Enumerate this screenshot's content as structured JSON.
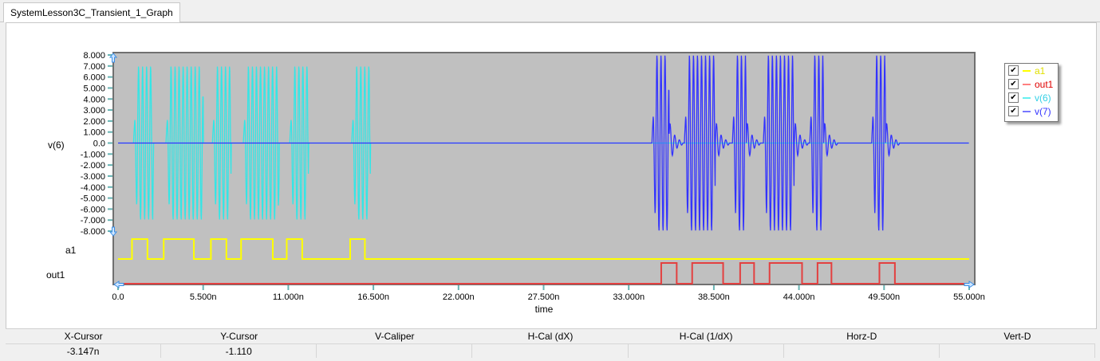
{
  "tab": {
    "title": "SystemLesson3C_Transient_1_Graph"
  },
  "colors": {
    "a1": "#ffff00",
    "out1": "#e34040",
    "v6": "#33e6e6",
    "v7": "#3333ff",
    "plot_bg": "#c0c0c0"
  },
  "chart_data": {
    "type": "line",
    "xlabel": "time",
    "xlim": [
      0,
      55
    ],
    "x_unit": "n",
    "x_ticks": [
      "0.0",
      "5.500n",
      "11.000n",
      "16.500n",
      "22.000n",
      "27.500n",
      "33.000n",
      "38.500n",
      "44.000n",
      "49.500n",
      "55.000n"
    ],
    "analog": {
      "ylabel": "v(6)",
      "ylim": [
        -8,
        8
      ],
      "y_ticks": [
        "8.000",
        "7.000",
        "6.000",
        "5.000",
        "4.000",
        "3.000",
        "2.000",
        "1.000",
        "0.0",
        "-1.000",
        "-2.000",
        "-3.000",
        "-4.000",
        "-5.000",
        "-6.000",
        "-7.000",
        "-8.000"
      ],
      "series": [
        {
          "name": "v(6)",
          "color": "#33e6e6",
          "amplitude": 7,
          "bursts": [
            [
              1.0,
              2.3
            ],
            [
              3.1,
              5.5
            ],
            [
              6.1,
              7.3
            ],
            [
              8.1,
              10.4
            ],
            [
              11.1,
              12.3
            ],
            [
              15.1,
              16.3
            ]
          ]
        },
        {
          "name": "v(7)",
          "color": "#3333ff",
          "amplitude": 8,
          "bursts": [
            [
              34.5,
              35.6
            ],
            [
              36.6,
              38.6
            ],
            [
              39.7,
              40.6
            ],
            [
              41.7,
              43.7
            ],
            [
              44.7,
              45.6
            ],
            [
              48.7,
              49.6
            ]
          ]
        }
      ]
    },
    "digital": [
      {
        "name": "a1",
        "color": "#ffff00",
        "high_intervals": [
          [
            0.9,
            1.9
          ],
          [
            2.95,
            4.9
          ],
          [
            6.0,
            7.0
          ],
          [
            7.95,
            10.0
          ],
          [
            10.9,
            11.9
          ],
          [
            15.0,
            15.95
          ]
        ]
      },
      {
        "name": "out1",
        "color": "#e34040",
        "high_intervals": [
          [
            35.1,
            36.1
          ],
          [
            37.1,
            39.1
          ],
          [
            40.2,
            41.1
          ],
          [
            42.1,
            44.2
          ],
          [
            45.2,
            46.1
          ],
          [
            49.2,
            50.2
          ]
        ]
      }
    ],
    "legend": {
      "placement": "right",
      "entries": [
        {
          "label": "a1",
          "checked": true,
          "color": "#ffff00"
        },
        {
          "label": "out1",
          "checked": true,
          "color": "#e34040"
        },
        {
          "label": "v(6)",
          "checked": true,
          "color": "#33e6e6"
        },
        {
          "label": "v(7)",
          "checked": true,
          "color": "#3333ff"
        }
      ]
    }
  },
  "cursor_table": {
    "headers": [
      "X-Cursor",
      "Y-Cursor",
      "V-Caliper",
      "H-Cal (dX)",
      "H-Cal (1/dX)",
      "Horz-D",
      "Vert-D"
    ],
    "values": [
      "-3.147n",
      "-1.110",
      "",
      "",
      "",
      "",
      ""
    ]
  }
}
